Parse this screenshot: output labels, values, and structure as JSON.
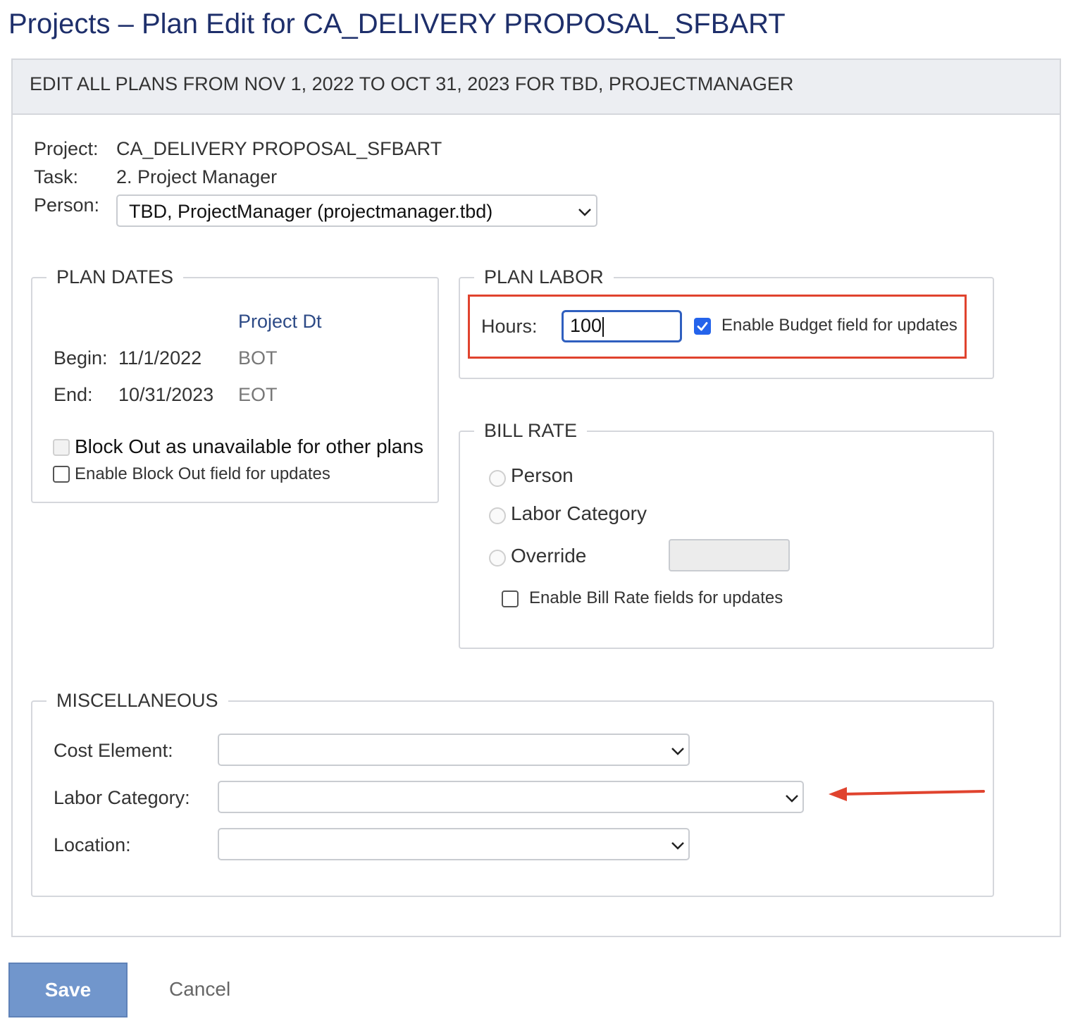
{
  "page": {
    "title": "Projects – Plan Edit for CA_DELIVERY PROPOSAL_SFBART",
    "header": "EDIT ALL PLANS FROM NOV 1, 2022 TO OCT 31, 2023 FOR TBD, PROJECTMANAGER"
  },
  "info": {
    "project_label": "Project:",
    "project_value": "CA_DELIVERY PROPOSAL_SFBART",
    "task_label": "Task:",
    "task_value": "2. Project Manager",
    "person_label": "Person:",
    "person_selected": "TBD, ProjectManager (projectmanager.tbd)"
  },
  "plan_dates": {
    "legend": "PLAN DATES",
    "column_header": "Project Dt",
    "begin_label": "Begin:",
    "begin_value": "11/1/2022",
    "begin_project": "BOT",
    "end_label": "End:",
    "end_value": "10/31/2023",
    "end_project": "EOT",
    "block_out_label": "Block Out as unavailable for other plans",
    "enable_block_out_label": "Enable Block Out field for updates"
  },
  "plan_labor": {
    "legend": "PLAN LABOR",
    "hours_label": "Hours:",
    "hours_value": "100",
    "enable_budget_label": "Enable Budget field for updates",
    "enable_budget_checked": true
  },
  "bill_rate": {
    "legend": "BILL RATE",
    "option_person": "Person",
    "option_labor_category": "Labor Category",
    "option_override": "Override",
    "override_value": "",
    "enable_label": "Enable Bill Rate fields for updates"
  },
  "misc": {
    "legend": "MISCELLANEOUS",
    "cost_element_label": "Cost Element:",
    "cost_element_value": "",
    "labor_category_label": "Labor Category:",
    "labor_category_value": "",
    "location_label": "Location:",
    "location_value": ""
  },
  "actions": {
    "save_label": "Save",
    "cancel_label": "Cancel"
  },
  "colors": {
    "title": "#1e2f6b",
    "save_button": "#7196cc",
    "annotation": "#e0432e",
    "checkbox_checked": "#2463eb"
  },
  "icons": [
    "chevron-down-icon",
    "checkmark-icon",
    "arrow-left-icon"
  ]
}
